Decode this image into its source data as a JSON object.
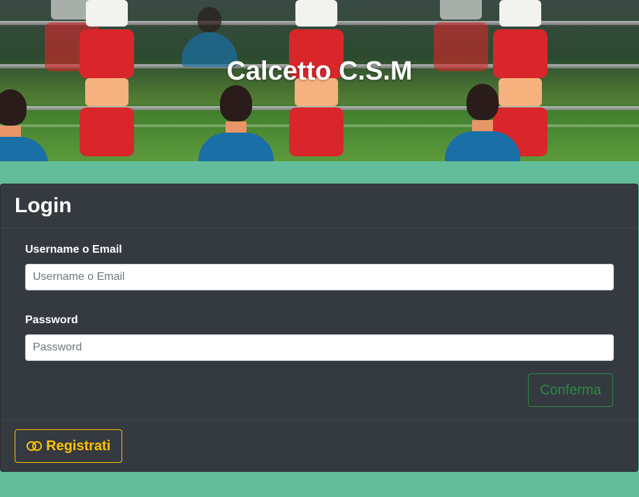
{
  "hero": {
    "title": "Calcetto C.S.M"
  },
  "login": {
    "title": "Login",
    "username_label": "Username o Email",
    "username_placeholder": "Username o Email",
    "username_value": "",
    "password_label": "Password",
    "password_placeholder": "Password",
    "password_value": "",
    "confirm_label": "Conferma",
    "register_label": "Registrati",
    "register_icon": "toggle-icon"
  },
  "colors": {
    "background": "#63bd9a",
    "card": "#343a40",
    "confirm": "#28a745",
    "register": "#ffc107"
  }
}
